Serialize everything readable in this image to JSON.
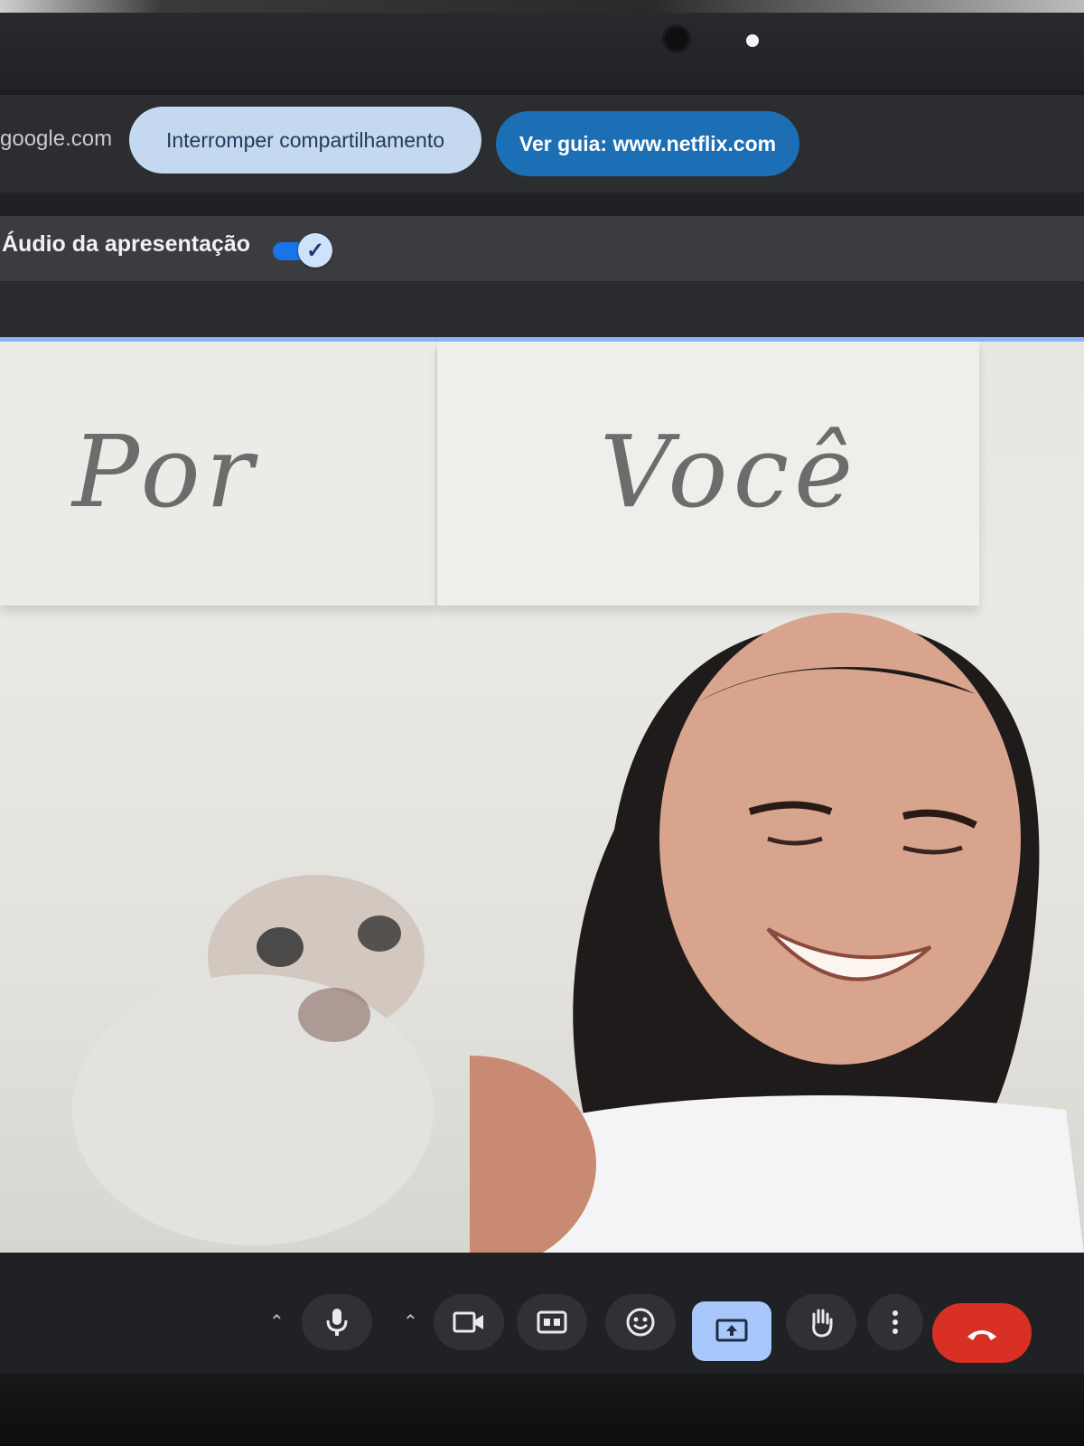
{
  "share_bar": {
    "domain": "google.com",
    "stop_sharing_label": "Interromper compartilhamento",
    "view_guide_label": "Ver guia: www.netflix.com"
  },
  "audio_bar": {
    "label": "Áudio da apresentação",
    "enabled": true
  },
  "video": {
    "wall_text_left": "Por",
    "wall_text_right": "Você"
  },
  "controls": {
    "items": [
      "mic-icon",
      "camera-icon",
      "captions-icon",
      "emoji-icon",
      "present-icon",
      "raise-hand-icon",
      "more-icon",
      "end-call-icon"
    ],
    "active": "present-icon",
    "end_call_color": "#d93025"
  },
  "colors": {
    "accent": "#8ab4f8",
    "guide_button": "#1c6fb4",
    "stop_button": "#c4d8ef"
  }
}
